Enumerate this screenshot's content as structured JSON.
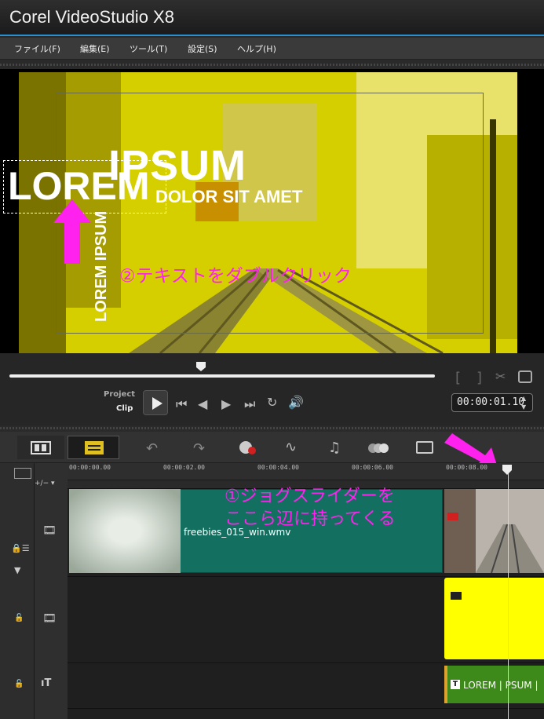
{
  "app": {
    "title": "Corel VideoStudio X8"
  },
  "menu": [
    "ファイル(F)",
    "編集(E)",
    "ツール(T)",
    "設定(S)",
    "ヘルプ(H)"
  ],
  "preview": {
    "ipsum": "IPSUM",
    "lorem": "LOREM",
    "dolor": "DOLOR SIT AMET",
    "vertical": "LOREM IPSUM",
    "annotation": "②テキストをダブルクリック"
  },
  "playback": {
    "project_label": "Project",
    "clip_label": "Clip",
    "timecode": "00:00:01.10",
    "scrub_position": 0.45
  },
  "ruler": {
    "ticks": [
      "00:00:00.00",
      "00:00:02.00",
      "00:00:04.00",
      "00:00:06.00",
      "00:00:08.00"
    ]
  },
  "timeline": {
    "video_clip_label": "freebies_015_win.wmv",
    "title_clip_label": "LOREM | PSUM |",
    "annotation_line1": "①ジョグスライダーを",
    "annotation_line2": "ここら辺に持ってくる"
  },
  "colors": {
    "accent": "#2b8fd0",
    "annotation": "#ff22ee",
    "video_clip": "#137060",
    "title_clip": "#3d8a1b",
    "overlay": "#ffff00"
  }
}
